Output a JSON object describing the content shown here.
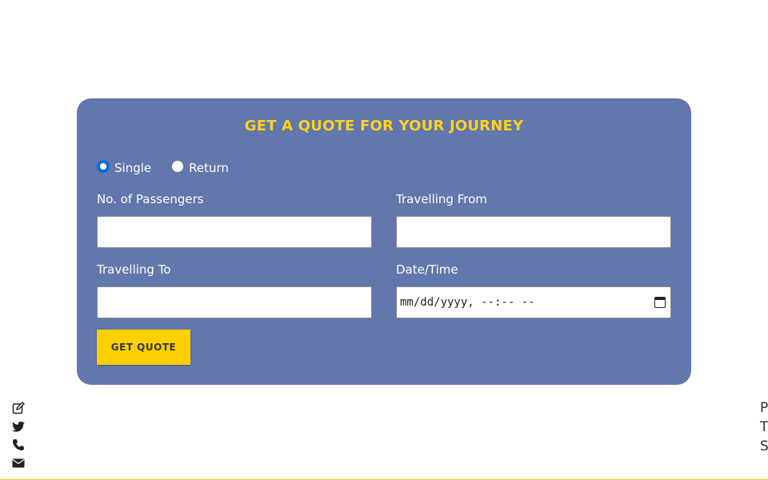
{
  "quote_form": {
    "title": "GET A QUOTE FOR YOUR JOURNEY",
    "trip_type": {
      "single_label": "Single",
      "return_label": "Return",
      "selected": "Single"
    },
    "fields": {
      "passengers_label": "No. of Passengers",
      "passengers_value": "",
      "from_label": "Travelling From",
      "from_value": "",
      "to_label": "Travelling To",
      "to_value": "",
      "datetime_label": "Date/Time",
      "datetime_value": "mm/dd/yyyy, --:-- --"
    },
    "submit_label": "GET QUOTE"
  },
  "side_icons": [
    "edit-icon",
    "twitter-icon",
    "phone-icon",
    "envelope-icon"
  ],
  "right_edge_text": [
    "P",
    "T",
    "S"
  ],
  "colors": {
    "card_background": "#6277ab",
    "title_color": "#ffd21f",
    "button_background": "#ffd000",
    "radio_checked": "#0b6bd6"
  }
}
